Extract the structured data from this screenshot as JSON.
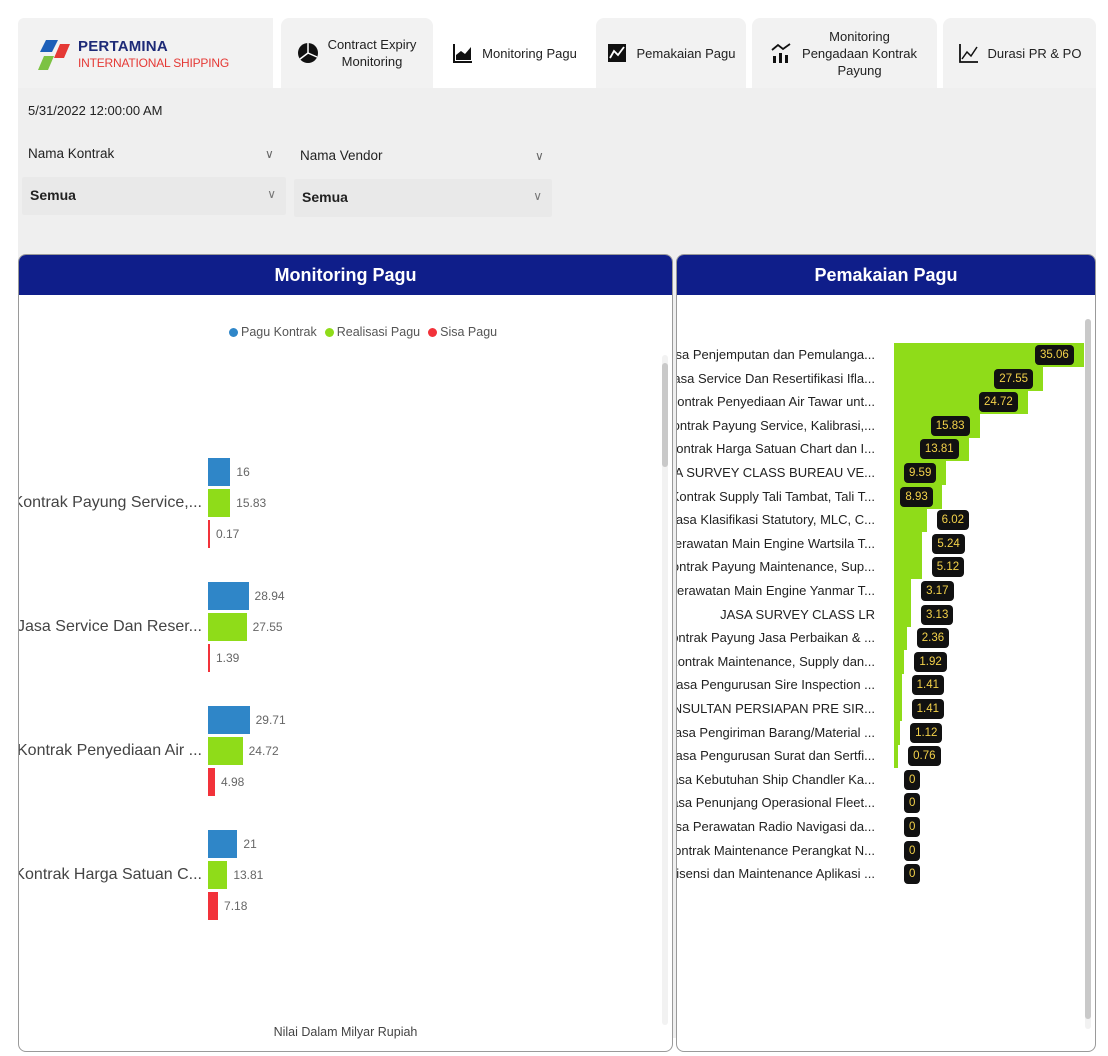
{
  "brand": {
    "title": "PERTAMINA",
    "subtitle": "INTERNATIONAL SHIPPING"
  },
  "tabs": [
    {
      "label": "Contract Expiry Monitoring",
      "icon": "pie-chart-icon",
      "active": false
    },
    {
      "label": "Monitoring Pagu",
      "icon": "area-chart-icon",
      "active": true
    },
    {
      "label": "Pemakaian Pagu",
      "icon": "line-chart-icon",
      "active": false
    },
    {
      "label": "Monitoring Pengadaan Kontrak Payung",
      "icon": "bar-line-chart-icon",
      "active": false
    },
    {
      "label": "Durasi PR & PO",
      "icon": "trend-chart-icon",
      "active": false
    }
  ],
  "filters": {
    "date": "5/31/2022 12:00:00 AM",
    "kontrak": {
      "label": "Nama Kontrak",
      "value": "Semua"
    },
    "vendor": {
      "label": "Nama Vendor",
      "value": "Semua"
    }
  },
  "colors": {
    "header": "#0f1e8a",
    "pagu_kontrak": "#2f86c8",
    "realisasi_pagu": "#8fdc19",
    "sisa_pagu": "#f2323a",
    "value_label_bg": "#111111",
    "value_label_text": "#f4d24a"
  },
  "chart_data": [
    {
      "type": "bar",
      "title": "Monitoring Pagu",
      "orientation": "horizontal",
      "xlabel": "Nilai Dalam Milyar Rupiah",
      "legend": "top-center",
      "categories": [
        "Kontrak Payung Service,...",
        "Jasa Service Dan Reser...",
        "Kontrak Penyediaan Air ...",
        "Kontrak Harga Satuan C..."
      ],
      "series": [
        {
          "name": "Pagu Kontrak",
          "values": [
            16,
            28.94,
            29.71,
            21
          ]
        },
        {
          "name": "Realisasi Pagu",
          "values": [
            15.83,
            27.55,
            24.72,
            13.81
          ]
        },
        {
          "name": "Sisa Pagu",
          "values": [
            0.17,
            1.39,
            4.98,
            7.18
          ]
        }
      ]
    },
    {
      "type": "bar",
      "title": "Pemakaian Pagu",
      "orientation": "horizontal",
      "categories": [
        "Jasa Penjemputan dan Pemulanga...",
        "Jasa Service Dan Resertifikasi Ifla...",
        "Kontrak Penyediaan Air Tawar unt...",
        "Kontrak Payung Service, Kalibrasi,...",
        "Kontrak Harga Satuan Chart dan I...",
        "JASA SURVEY CLASS BUREAU VE...",
        "Kontrak Supply Tali Tambat, Tali T...",
        "Jasa Klasifikasi Statutory, MLC, C...",
        "Perawatan Main Engine Wartsila T...",
        "Kontrak Payung Maintenance, Sup...",
        "Perawatan Main Engine Yanmar T...",
        "JASA SURVEY CLASS LR",
        "Kontrak Payung Jasa Perbaikan & ...",
        "Kontrak Maintenance, Supply dan...",
        "Jasa Pengurusan Sire Inspection ...",
        "KONSULTAN PERSIAPAN PRE SIR...",
        "Jasa Pengiriman Barang/Material ...",
        "Jasa Pengurusan Surat dan Sertfi...",
        "Jasa Kebutuhan Ship Chandler Ka...",
        "Jasa Penunjang Operasional Fleet...",
        "Jasa Perawatan Radio Navigasi da...",
        "Kontrak Maintenance Perangkat N...",
        "Lisensi dan Maintenance Aplikasi ..."
      ],
      "values": [
        35.06,
        27.55,
        24.72,
        15.83,
        13.81,
        9.59,
        8.93,
        6.02,
        5.24,
        5.12,
        3.17,
        3.13,
        2.36,
        1.92,
        1.41,
        1.41,
        1.12,
        0.76,
        0,
        0,
        0,
        0,
        0
      ]
    }
  ]
}
